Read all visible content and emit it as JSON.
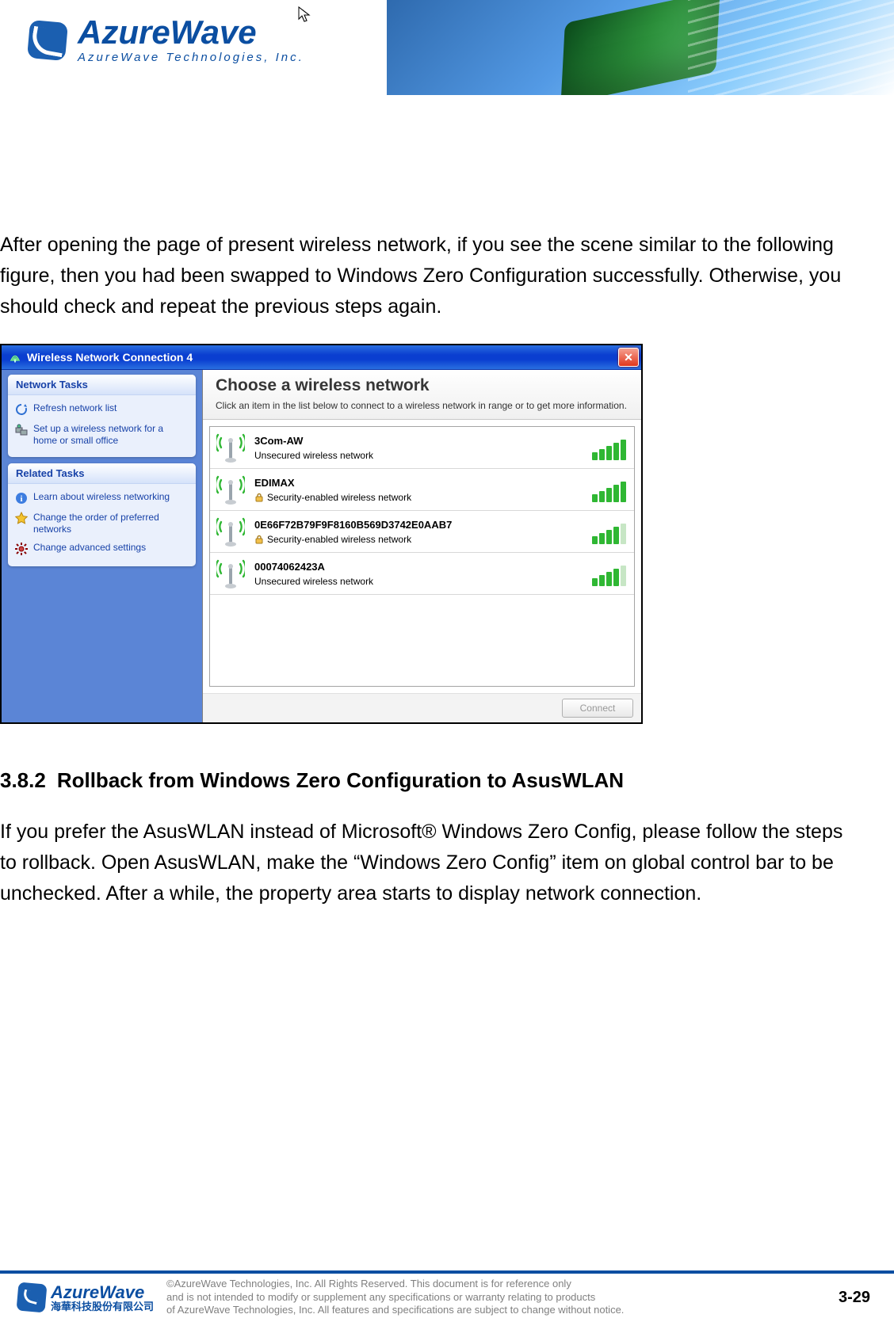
{
  "header": {
    "brand": "AzureWave",
    "tagline": "AzureWave   Technologies,   Inc."
  },
  "body": {
    "intro_para": "After opening the page of present wireless network, if you see the scene similar to the following figure, then you had been swapped to Windows Zero Configuration successfully. Otherwise, you should check and repeat the previous steps again.",
    "section_num": "3.8.2",
    "section_title": "Rollback from Windows Zero Configuration to AsusWLAN",
    "section_para": "If you prefer the AsusWLAN instead of Microsoft® Windows Zero Config, please follow the steps to rollback. Open AsusWLAN, make the “Windows Zero Config” item on global control bar to be unchecked. After a while, the property area starts to display network connection."
  },
  "xp": {
    "title": "Wireless Network Connection 4",
    "sidebar": {
      "panel1_title": "Network Tasks",
      "panel1_items": [
        {
          "icon": "refresh",
          "label": "Refresh network list"
        },
        {
          "icon": "setup",
          "label": "Set up a wireless network for a home or small office"
        }
      ],
      "panel2_title": "Related Tasks",
      "panel2_items": [
        {
          "icon": "info",
          "label": "Learn about wireless networking"
        },
        {
          "icon": "star",
          "label": "Change the order of preferred networks"
        },
        {
          "icon": "gear",
          "label": "Change advanced settings"
        }
      ]
    },
    "main": {
      "heading": "Choose a wireless network",
      "sub": "Click an item in the list below to connect to a wireless network in range or to get more information.",
      "connect_label": "Connect",
      "networks": [
        {
          "ssid": "3Com-AW",
          "desc": "Unsecured wireless network",
          "secured": false,
          "signal": 5
        },
        {
          "ssid": "EDIMAX",
          "desc": "Security-enabled wireless network",
          "secured": true,
          "signal": 5
        },
        {
          "ssid": "0E66F72B79F9F8160B569D3742E0AAB7",
          "desc": "Security-enabled wireless network",
          "secured": true,
          "signal": 4
        },
        {
          "ssid": "00074062423A",
          "desc": "Unsecured wireless network",
          "secured": false,
          "signal": 4
        }
      ]
    }
  },
  "footer": {
    "brand": "AzureWave",
    "brand_cn": "海華科技股份有限公司",
    "copyright_l1": "©AzureWave Technologies, Inc. All Rights Reserved. This document is for reference only",
    "copyright_l2": "and is not intended to modify or supplement any specifications or  warranty relating to products",
    "copyright_l3": "of AzureWave Technologies, Inc.  All features and specifications are subject to change without notice.",
    "page_num": "3-29"
  }
}
